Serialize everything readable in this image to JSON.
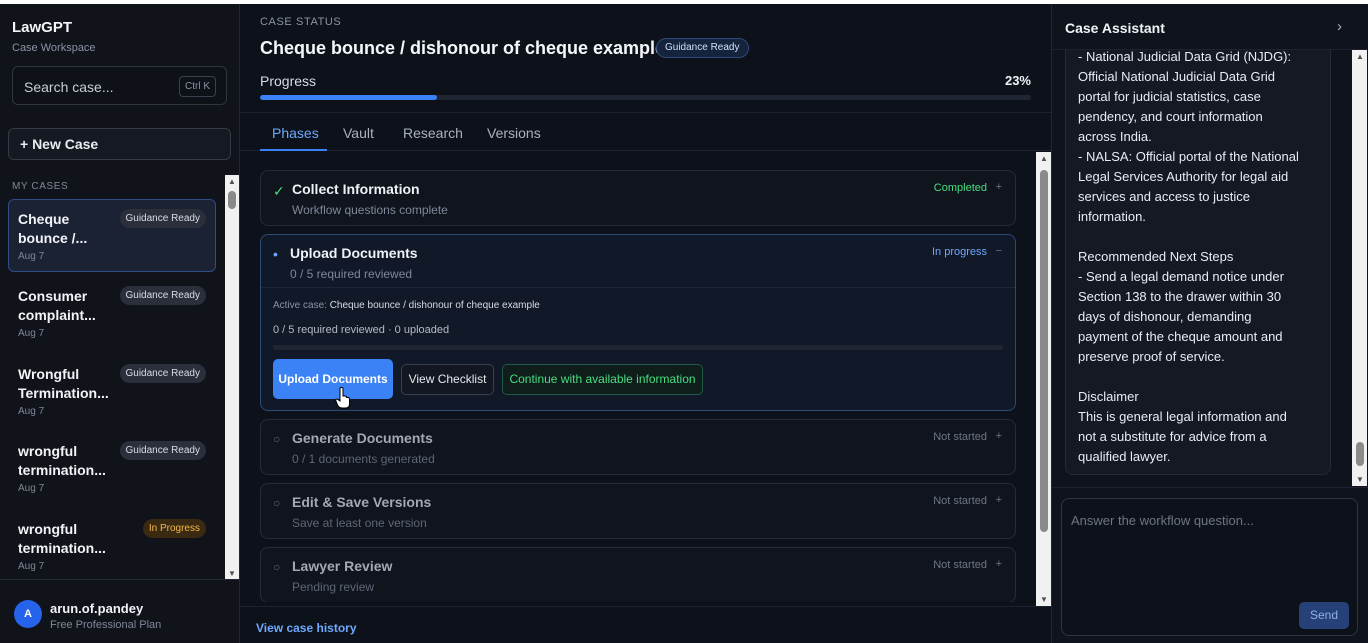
{
  "sidebar": {
    "brand": "LawGPT",
    "brand_sub": "Case Workspace",
    "search_placeholder": "Search case...",
    "search_shortcut": "Ctrl K",
    "new_case_label": "+ New Case",
    "section_label": "MY CASES",
    "cases": [
      {
        "title": "Cheque bounce /...",
        "date": "Aug 7",
        "badge": "Guidance Ready"
      },
      {
        "title": "Consumer complaint...",
        "date": "Aug 7",
        "badge": "Guidance Ready"
      },
      {
        "title": "Wrongful Termination...",
        "date": "Aug 7",
        "badge": "Guidance Ready"
      },
      {
        "title": "wrongful termination...",
        "date": "Aug 7",
        "badge": "Guidance Ready"
      },
      {
        "title": "wrongful termination...",
        "date": "Aug 7",
        "badge": "In Progress"
      }
    ],
    "user": {
      "initial": "A",
      "name": "arun.of.pandey",
      "plan": "Free Professional Plan"
    }
  },
  "main": {
    "eyebrow": "CASE STATUS",
    "title": "Cheque bounce / dishonour of cheque example",
    "title_badge": "Guidance Ready",
    "progress_label": "Progress",
    "progress_text": "23%",
    "progress_value": 23,
    "tabs": [
      "Phases",
      "Vault",
      "Research",
      "Versions"
    ],
    "active_tab": "Phases",
    "phases": [
      {
        "title": "Collect Information",
        "subtitle": "Workflow questions complete",
        "status": "Completed",
        "toggle": "+"
      },
      {
        "title": "Upload Documents",
        "subtitle": "0 / 5 required reviewed",
        "status": "In progress",
        "toggle": "−"
      },
      {
        "title": "Generate Documents",
        "subtitle": "0 / 1 documents generated",
        "status": "Not started",
        "toggle": "+"
      },
      {
        "title": "Edit & Save Versions",
        "subtitle": "Save at least one version",
        "status": "Not started",
        "toggle": "+"
      },
      {
        "title": "Lawyer Review",
        "subtitle": "Pending review",
        "status": "Not started",
        "toggle": "+"
      }
    ],
    "upload_panel": {
      "active_case_label": "Active case:",
      "active_case_value": "Cheque bounce / dishonour of cheque example",
      "count_text": "0 / 5 required reviewed · 0 uploaded",
      "upload_progress": 0,
      "upload_button": "Upload Documents",
      "checklist_button": "View Checklist",
      "continue_button": "Continue with available information"
    },
    "history_link": "View case history"
  },
  "assistant": {
    "title": "Case Assistant",
    "close_icon": "chevron-right-icon",
    "messages": [
      "- National Judicial Data Grid (NJDG):",
      "Official National Judicial Data Grid",
      "portal for judicial statistics, case",
      "pendency, and court information",
      "across India.",
      "- NALSA: Official portal of the National",
      "Legal Services Authority for legal aid",
      "services and access to justice",
      "information.",
      "",
      "Recommended Next Steps",
      "- Send a legal demand notice under",
      "Section 138 to the drawer within 30",
      "days of dishonour, demanding",
      "payment of the cheque amount and",
      "preserve proof of service.",
      "",
      "Disclaimer",
      "This is general legal information and",
      "not a substitute for advice from a",
      "qualified lawyer."
    ],
    "input_placeholder": "Answer the workflow question...",
    "send_label": "Send"
  },
  "colors": {
    "accent": "#3b82f6",
    "completed": "#4ade80",
    "in_progress": "#6ea8ff",
    "warning_badge": "#f4b74a"
  }
}
